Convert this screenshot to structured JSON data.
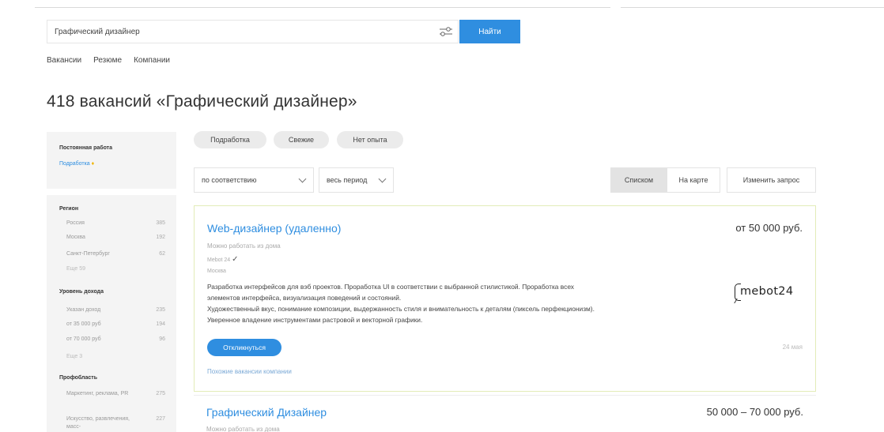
{
  "search": {
    "query": "Графический дизайнер",
    "button_label": "Найти"
  },
  "tabs": [
    {
      "label": "Вакансии",
      "active": true
    },
    {
      "label": "Резюме",
      "active": false
    },
    {
      "label": "Компании",
      "active": false
    }
  ],
  "page_title": "418 вакансий «Графический дизайнер»",
  "sidebar": {
    "employment": {
      "heading": "Постоянная работа",
      "link": "Подработка",
      "link_icon": "flame-icon"
    },
    "region": {
      "heading": "Регион",
      "items": [
        {
          "name": "Россия",
          "count": "385"
        },
        {
          "name": "Москва",
          "count": "192"
        },
        {
          "name": "Санкт-Петербург",
          "count": "62"
        }
      ],
      "more": "Еще 59"
    },
    "income": {
      "heading": "Уровень дохода",
      "items": [
        {
          "name": "Указан доход",
          "count": "235"
        },
        {
          "name": "от 35 000 руб",
          "count": "194"
        },
        {
          "name": "от 70 000 руб",
          "count": "96"
        }
      ],
      "more": "Еще 3"
    },
    "field": {
      "heading": "Профобласть",
      "items": [
        {
          "name": "Маркетинг, реклама, PR",
          "count": "275"
        },
        {
          "name": "Искусство, развлечения, масс-",
          "count": "227"
        }
      ]
    }
  },
  "chips": [
    "Подработка",
    "Свежие",
    "Нет опыта"
  ],
  "sort": {
    "order": "по соответствию",
    "period": "весь период"
  },
  "view": {
    "list": "Списком",
    "map": "На карте",
    "edit": "Изменить запрос"
  },
  "vacancies": [
    {
      "title": "Web-дизайнер (удаленно)",
      "salary": "от 50 000 руб.",
      "remote": "Можно работать из дома",
      "company": "Mebot 24",
      "city": "Москва",
      "description": [
        "Разработка интерфейсов для вэб проектов. Проработка UI в соответствии с выбранной стилистикой. Проработка всех",
        "элементов интерфейса, визуализация поведений и состояний.",
        "Художественный вкус, понимание композиции, выдержанность стиля и внимательность к деталям (пиксель перфекционизм).",
        "Уверенное владение инструментами растровой и векторной графики."
      ],
      "respond_label": "Откликнуться",
      "date": "24 мая",
      "similar_label": "Похожие вакансии компании",
      "logo_text": "mebot24"
    },
    {
      "title": "Графический Дизайнер",
      "salary": "50 000 – 70 000 руб.",
      "remote": "Можно работать из дома"
    }
  ],
  "colors": {
    "accent": "#2f8ee0",
    "tab_underline": "#7ec255",
    "sidebar_bg": "#f4f4f4",
    "highlight_border": "#e3ecb8"
  }
}
